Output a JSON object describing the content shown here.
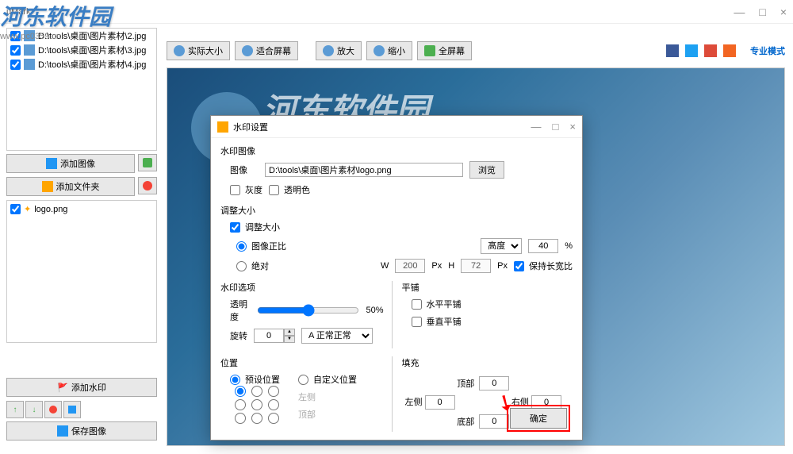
{
  "app_title": "uMark",
  "watermark_brand": "河东软件园",
  "watermark_url": "www.pc0359.cn",
  "window_controls": {
    "min": "—",
    "max": "□",
    "close": "×"
  },
  "files": [
    "D:\\tools\\桌面\\图片素材\\2.jpg",
    "D:\\tools\\桌面\\图片素材\\3.jpg",
    "D:\\tools\\桌面\\图片素材\\4.jpg"
  ],
  "side": {
    "add_image": "添加图像",
    "add_folder": "添加文件夹",
    "add_watermark": "添加水印",
    "save_image": "保存图像"
  },
  "logo_file": "logo.png",
  "toolbar": {
    "actual_size": "实际大小",
    "fit_screen": "适合屏幕",
    "zoom_in": "放大",
    "zoom_out": "缩小",
    "fullscreen": "全屏幕",
    "pro_mode": "专业模式"
  },
  "canvas_text": "河东软件园",
  "dialog": {
    "title": "水印设置",
    "section_image": "水印图像",
    "label_image": "图像",
    "image_path": "D:\\tools\\桌面\\图片素材\\logo.png",
    "browse": "浏览",
    "grayscale": "灰度",
    "transparent": "透明色",
    "section_resize": "调整大小",
    "resize_check": "调整大小",
    "proportional": "图像正比",
    "absolute": "绝对",
    "dimension": "高度",
    "percent_value": "40",
    "percent_unit": "%",
    "w_label": "W",
    "w_value": "200",
    "h_label": "H",
    "h_value": "72",
    "px_unit": "Px",
    "keep_ratio": "保持长宽比",
    "section_options": "水印选项",
    "opacity": "透明度",
    "opacity_value": "50%",
    "rotate": "旋转",
    "rotate_value": "0",
    "font_normal": "正常",
    "section_tile": "平铺",
    "tile_h": "水平平铺",
    "tile_v": "垂直平铺",
    "section_position": "位置",
    "preset_pos": "预设位置",
    "custom_pos": "自定义位置",
    "left": "左侧",
    "top": "顶部",
    "section_fill": "填充",
    "fill_top": "顶部",
    "fill_left": "左侧",
    "fill_right": "右侧",
    "fill_bottom": "底部",
    "fill_value": "0",
    "ok": "确定"
  }
}
